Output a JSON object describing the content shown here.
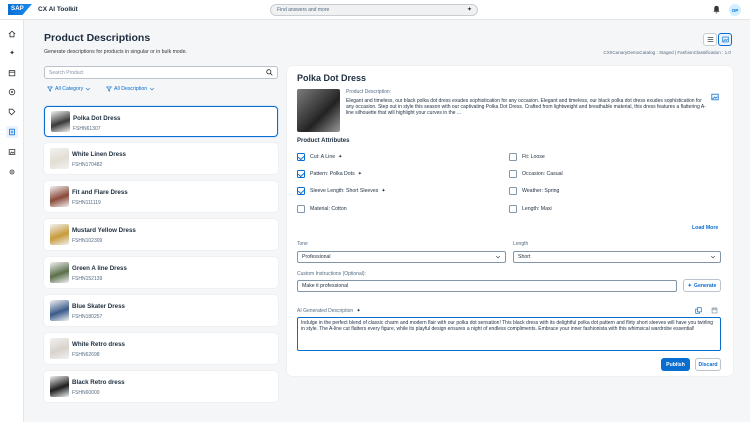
{
  "shell": {
    "logo": "SAP",
    "app_title": "CX AI Toolkit",
    "search_placeholder": "Find answers and more",
    "avatar_initials": "OP"
  },
  "page": {
    "title": "Product Descriptions",
    "subtitle": "Generate descriptions for products in singular or in bulk mode.",
    "catalog_info": "CXIICanaryDemoCatalog : Staged  |  FashionClassification : 1.0"
  },
  "list": {
    "search_placeholder": "Search Product",
    "filter_category": "All Category",
    "filter_description": "All Description",
    "products": [
      {
        "name": "Polka Dot Dress",
        "sku": "FSHN61307",
        "thumb": "#3a3a3a",
        "selected": true
      },
      {
        "name": "White Linen Dress",
        "sku": "FSHN170482",
        "thumb": "#e3ddd3",
        "selected": false
      },
      {
        "name": "Fit and Flare Dress",
        "sku": "FSHN111119",
        "thumb": "#8a4a3a",
        "selected": false
      },
      {
        "name": "Mustard Yellow Dress",
        "sku": "FSHN102309",
        "thumb": "#c89a3a",
        "selected": false
      },
      {
        "name": "Green A line Dress",
        "sku": "FSHN152139",
        "thumb": "#5a6f4a",
        "selected": false
      },
      {
        "name": "Blue Skater Dress",
        "sku": "FSHN180257",
        "thumb": "#3a5a8a",
        "selected": false
      },
      {
        "name": "White Retro dress",
        "sku": "FSHN62698",
        "thumb": "#d8d2cc",
        "selected": false
      },
      {
        "name": "Black Retro dress",
        "sku": "FSHN60000",
        "thumb": "#1e1e1e",
        "selected": false
      }
    ]
  },
  "detail": {
    "title": "Polka Dot Dress",
    "description_label": "Product Description:",
    "description": "Elegant and timeless, our black polka dot dress exudes sophistication for any occasion. Elegant and timeless, our black polka dot dress exudes sophistication for any occasion. Step out in style this season with our captivating Polka Dot Dress. Crafted from lightweight and breathable material, this dress features a flattering A-line silhouette that will highlight your curves in the ...",
    "attributes_heading": "Product Attributes",
    "attributes_left": [
      {
        "label": "Cut: A Line",
        "checked": true,
        "ai": true
      },
      {
        "label": "Pattern: Polka Dots",
        "checked": true,
        "ai": true
      },
      {
        "label": "Sleeve Length: Short Sleeves",
        "checked": true,
        "ai": true
      },
      {
        "label": "Material: Cotton",
        "checked": false,
        "ai": false
      }
    ],
    "attributes_right": [
      {
        "label": "Fit: Loose",
        "checked": false,
        "ai": false
      },
      {
        "label": "Occasion: Casual",
        "checked": false,
        "ai": false
      },
      {
        "label": "Weather: Spring",
        "checked": false,
        "ai": false
      },
      {
        "label": "Length: Maxi",
        "checked": false,
        "ai": false
      }
    ],
    "load_more": "Load More",
    "tone_label": "Tone",
    "tone_value": "Professional",
    "length_label": "Length",
    "length_value": "Short",
    "custom_label": "Custom Instructions (Optional):",
    "custom_value": "Make it professional",
    "generate_label": "Generate",
    "ai_desc_label": "AI Generated Description",
    "ai_desc_text": "Indulge in the perfect blend of classic charm and modern flair with our polka dot sensation! This black dress with its delightful polka dot pattern and flirty short sleeves will have you twirling in style. The A-line cut flatters every figure, while its playful design ensures a night of endless compliments. Embrace your inner fashionista with this whimsical wardrobe essential!",
    "publish_label": "Publish",
    "discard_label": "Discard"
  },
  "colors": {
    "accent": "#0a6ed1",
    "background": "#f5f6f7"
  }
}
